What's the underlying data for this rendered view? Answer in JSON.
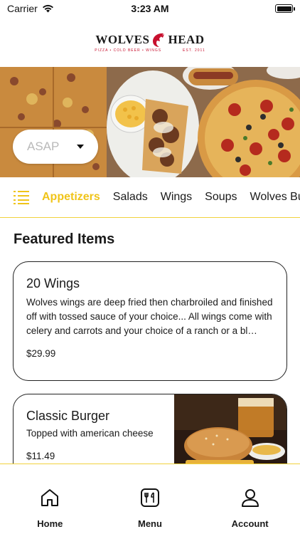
{
  "status_bar": {
    "carrier": "Carrier",
    "time": "3:23 AM",
    "battery_level": 1.0
  },
  "logo": {
    "left_word": "WOLVES",
    "right_word": "HEAD",
    "tagline": "PIZZA • COLD BEER • WINGS",
    "est": "EST. 2011",
    "brand_red": "#c8102e"
  },
  "hero": {
    "order_time_value": "ASAP"
  },
  "categories": {
    "icon": "list-icon",
    "items": [
      "Appetizers",
      "Salads",
      "Wings",
      "Soups",
      "Wolves Bur"
    ],
    "active_index": 0,
    "accent_color": "#f0c419"
  },
  "featured": {
    "title": "Featured Items",
    "items": [
      {
        "name": "20 Wings",
        "description": "Wolves wings are deep fried then charbroiled and finished off with tossed sauce of your choice... All wings come with celery and carrots and your choice of a ranch or a bl…",
        "price": "$29.99"
      },
      {
        "name": "Classic Burger",
        "description": "Topped with american cheese",
        "price": "$11.49"
      }
    ]
  },
  "tab_bar": {
    "tabs": [
      {
        "label": "Home",
        "icon": "home-icon"
      },
      {
        "label": "Menu",
        "icon": "menu-icon"
      },
      {
        "label": "Account",
        "icon": "account-icon"
      }
    ]
  }
}
